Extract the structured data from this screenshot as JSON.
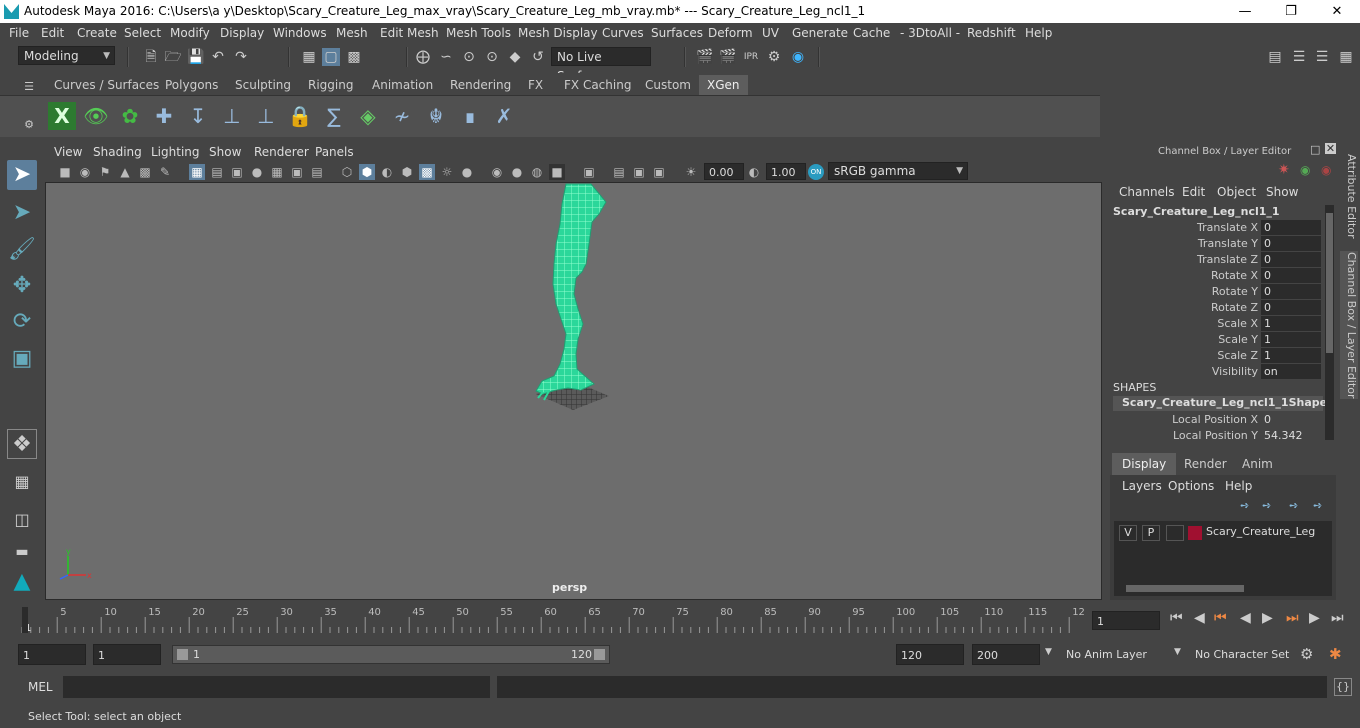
{
  "title": "Autodesk Maya 2016: C:\\Users\\a y\\Desktop\\Scary_Creature_Leg_max_vray\\Scary_Creature_Leg_mb_vray.mb*  ---  Scary_Creature_Leg_ncl1_1",
  "menu": [
    "File",
    "Edit",
    "Create",
    "Select",
    "Modify",
    "Display",
    "Windows",
    "Mesh",
    "Edit Mesh",
    "Mesh Tools",
    "Mesh Display",
    "Curves",
    "Surfaces",
    "Deform",
    "UV",
    "Generate",
    "Cache",
    "- 3DtoAll -",
    "Redshift",
    "Help"
  ],
  "mode_dropdown": "Modeling",
  "live_surface": "No Live Surface",
  "shelf_tabs": [
    "Curves / Surfaces",
    "Polygons",
    "Sculpting",
    "Rigging",
    "Animation",
    "Rendering",
    "FX",
    "FX Caching",
    "Custom",
    "XGen"
  ],
  "active_shelf_tab": "XGen",
  "viewport_menu": [
    "View",
    "Shading",
    "Lighting",
    "Show",
    "Renderer",
    "Panels"
  ],
  "viewport": {
    "near_value": "0.00",
    "far_value": "1.00",
    "color_space": "sRGB gamma",
    "camera_label": "persp"
  },
  "channel_box": {
    "title": "Channel Box / Layer Editor",
    "menu": [
      "Channels",
      "Edit",
      "Object",
      "Show"
    ],
    "object_name": "Scary_Creature_Leg_ncl1_1",
    "channels": [
      {
        "name": "Translate X",
        "value": "0"
      },
      {
        "name": "Translate Y",
        "value": "0"
      },
      {
        "name": "Translate Z",
        "value": "0"
      },
      {
        "name": "Rotate X",
        "value": "0"
      },
      {
        "name": "Rotate Y",
        "value": "0"
      },
      {
        "name": "Rotate Z",
        "value": "0"
      },
      {
        "name": "Scale X",
        "value": "1"
      },
      {
        "name": "Scale Y",
        "value": "1"
      },
      {
        "name": "Scale Z",
        "value": "1"
      },
      {
        "name": "Visibility",
        "value": "on"
      }
    ],
    "shapes_header": "SHAPES",
    "shape_name": "Scary_Creature_Leg_ncl1_1Shape",
    "shape_channels": [
      {
        "name": "Local Position X",
        "value": "0"
      },
      {
        "name": "Local Position Y",
        "value": "54.342"
      }
    ]
  },
  "side_tabs": [
    "Attribute Editor",
    "Channel Box / Layer Editor"
  ],
  "layer_editor": {
    "tabs": [
      "Display",
      "Render",
      "Anim"
    ],
    "active_tab": "Display",
    "menu": [
      "Layers",
      "Options",
      "Help"
    ],
    "layer": {
      "v": "V",
      "p": "P",
      "name": "Scary_Creature_Leg",
      "color": "#a01030"
    }
  },
  "timeline": {
    "ticks": [
      "1",
      "5",
      "10",
      "15",
      "20",
      "25",
      "30",
      "35",
      "40",
      "45",
      "50",
      "55",
      "60",
      "65",
      "70",
      "75",
      "80",
      "85",
      "90",
      "95",
      "100",
      "105",
      "110",
      "115",
      "12"
    ],
    "current_frame": "1"
  },
  "range": {
    "start": "1",
    "playback_start": "1",
    "slider_start": "1",
    "slider_end": "120",
    "playback_end": "120",
    "end": "200",
    "anim_layer": "No Anim Layer",
    "character_set": "No Character Set"
  },
  "mel_label": "MEL",
  "help_text": "Select Tool: select an object",
  "colors": {
    "mesh": "#3ef0a0",
    "selected_tool": "#5d7f9c",
    "layer_color": "#a01030"
  }
}
